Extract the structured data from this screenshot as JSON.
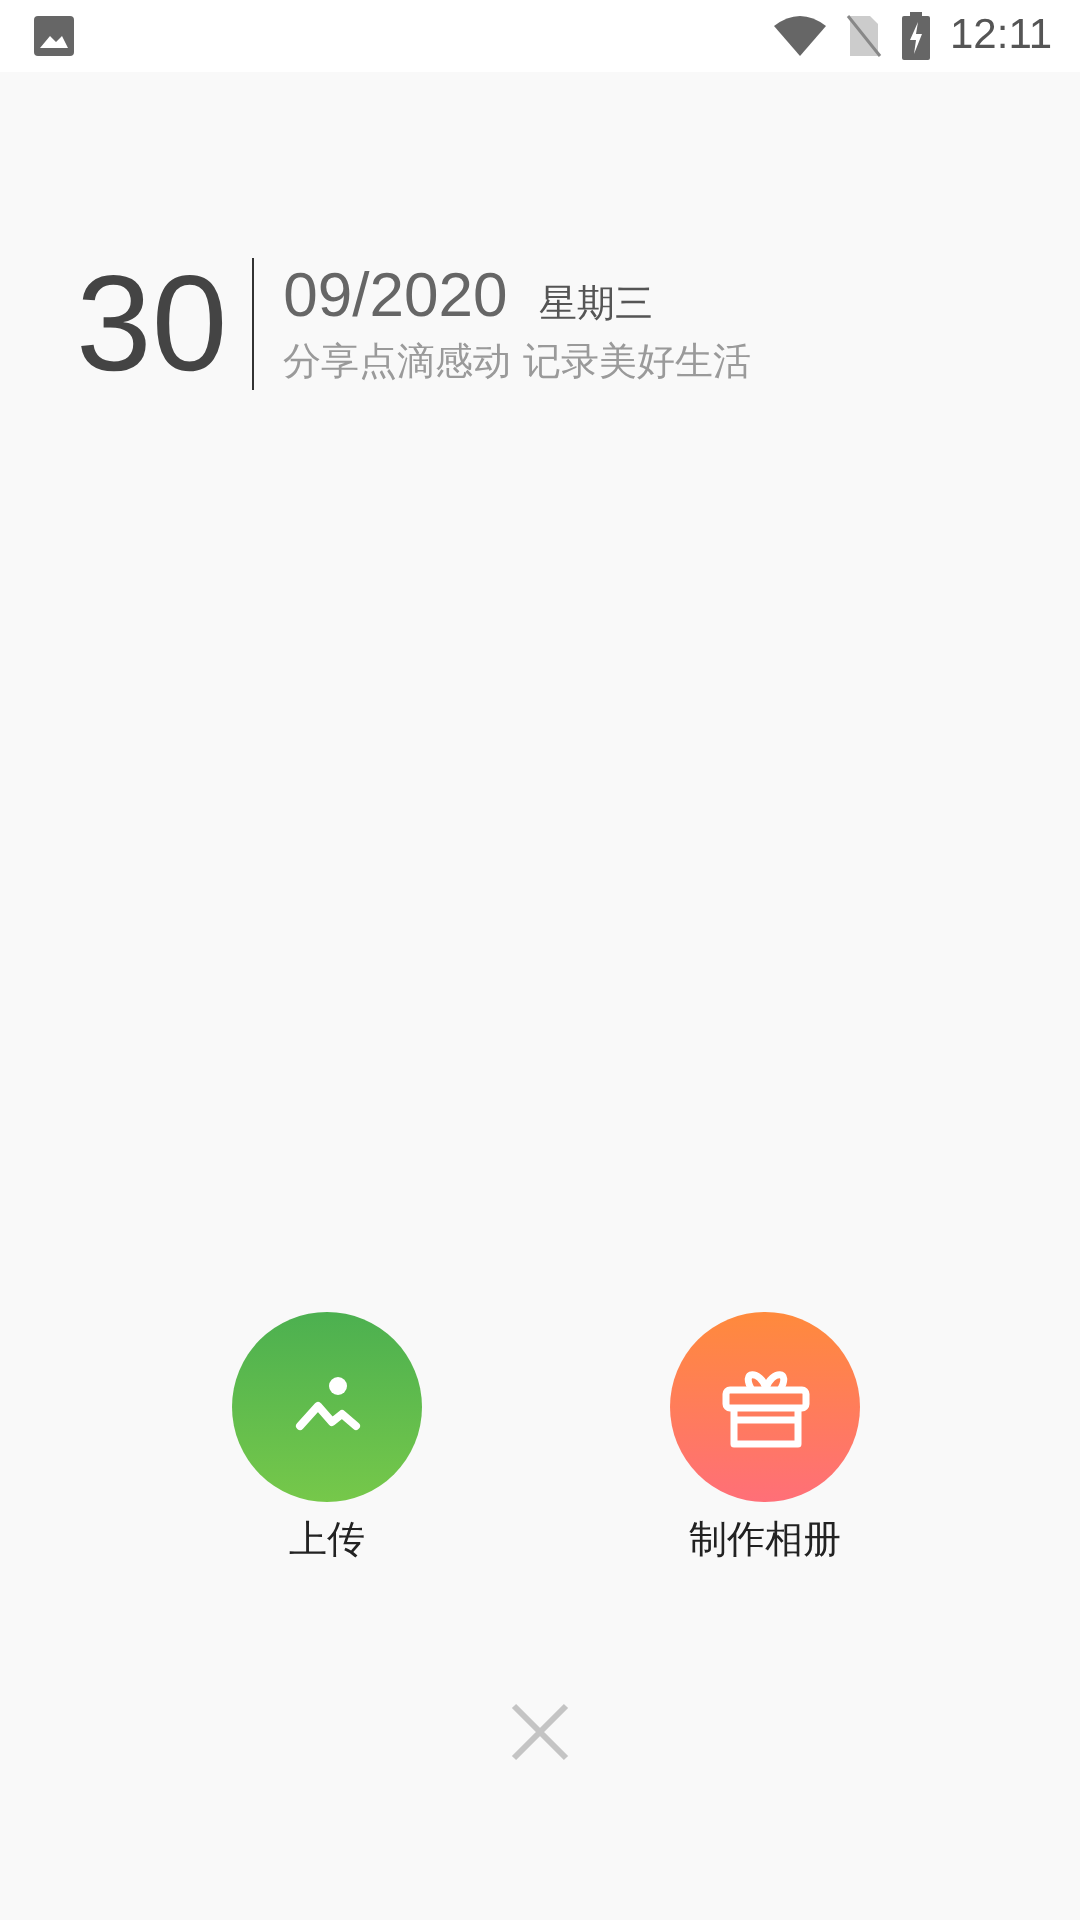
{
  "status_bar": {
    "time": "12:11"
  },
  "date": {
    "day": "30",
    "month_year": "09/2020",
    "weekday": "星期三",
    "slogan": "分享点滴感动 记录美好生活"
  },
  "actions": [
    {
      "kind": "upload",
      "label": "上传"
    },
    {
      "kind": "album",
      "label": "制作相册"
    }
  ]
}
